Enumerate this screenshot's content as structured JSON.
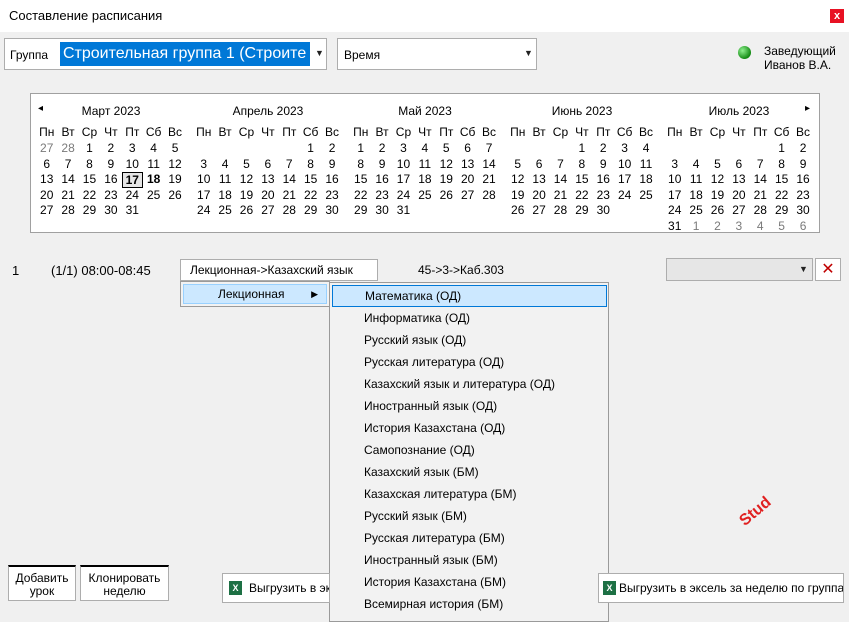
{
  "window": {
    "title": "Составление расписания",
    "close_label": "x"
  },
  "header": {
    "group_label": "Группа",
    "group_value": "Строительная группа 1 (Строите",
    "time_value": "Время",
    "user_role": "Заведующий",
    "user_name": "Иванов В.А.",
    "status_color": "#1a9a1a"
  },
  "calendar": {
    "prev_label": "◂",
    "next_label": "▸",
    "weekdays": [
      "Пн",
      "Вт",
      "Ср",
      "Чт",
      "Пт",
      "Сб",
      "Вс"
    ],
    "months": [
      {
        "title": "Март 2023",
        "weeks": [
          [
            "27",
            "28",
            "1",
            "2",
            "3",
            "4",
            "5"
          ],
          [
            "6",
            "7",
            "8",
            "9",
            "10",
            "11",
            "12"
          ],
          [
            "13",
            "14",
            "15",
            "16",
            "17",
            "18",
            "19"
          ],
          [
            "20",
            "21",
            "22",
            "23",
            "24",
            "25",
            "26"
          ],
          [
            "27",
            "28",
            "29",
            "30",
            "31",
            "",
            ""
          ]
        ],
        "dim": [
          [
            0,
            0
          ],
          [
            0,
            1
          ]
        ],
        "today": [
          2,
          4
        ],
        "bold": [
          [
            2,
            5
          ]
        ]
      },
      {
        "title": "Апрель 2023",
        "weeks": [
          [
            "",
            "",
            "",
            "",
            "",
            "1",
            "2"
          ],
          [
            "3",
            "4",
            "5",
            "6",
            "7",
            "8",
            "9"
          ],
          [
            "10",
            "11",
            "12",
            "13",
            "14",
            "15",
            "16"
          ],
          [
            "17",
            "18",
            "19",
            "20",
            "21",
            "22",
            "23"
          ],
          [
            "24",
            "25",
            "26",
            "27",
            "28",
            "29",
            "30"
          ]
        ],
        "dim": [],
        "today": null,
        "bold": []
      },
      {
        "title": "Май 2023",
        "weeks": [
          [
            "1",
            "2",
            "3",
            "4",
            "5",
            "6",
            "7"
          ],
          [
            "8",
            "9",
            "10",
            "11",
            "12",
            "13",
            "14"
          ],
          [
            "15",
            "16",
            "17",
            "18",
            "19",
            "20",
            "21"
          ],
          [
            "22",
            "23",
            "24",
            "25",
            "26",
            "27",
            "28"
          ],
          [
            "29",
            "30",
            "31",
            "",
            "",
            "",
            ""
          ]
        ],
        "dim": [],
        "today": null,
        "bold": []
      },
      {
        "title": "Июнь 2023",
        "weeks": [
          [
            "",
            "",
            "",
            "1",
            "2",
            "3",
            "4"
          ],
          [
            "5",
            "6",
            "7",
            "8",
            "9",
            "10",
            "11"
          ],
          [
            "12",
            "13",
            "14",
            "15",
            "16",
            "17",
            "18"
          ],
          [
            "19",
            "20",
            "21",
            "22",
            "23",
            "24",
            "25"
          ],
          [
            "26",
            "27",
            "28",
            "29",
            "30",
            "",
            ""
          ]
        ],
        "dim": [],
        "today": null,
        "bold": []
      },
      {
        "title": "Июль 2023",
        "weeks": [
          [
            "",
            "",
            "",
            "",
            "",
            "1",
            "2"
          ],
          [
            "3",
            "4",
            "5",
            "6",
            "7",
            "8",
            "9"
          ],
          [
            "10",
            "11",
            "12",
            "13",
            "14",
            "15",
            "16"
          ],
          [
            "17",
            "18",
            "19",
            "20",
            "21",
            "22",
            "23"
          ],
          [
            "24",
            "25",
            "26",
            "27",
            "28",
            "29",
            "30"
          ],
          [
            "31",
            "1",
            "2",
            "3",
            "4",
            "5",
            "6"
          ]
        ],
        "dim": [
          [
            5,
            1
          ],
          [
            5,
            2
          ],
          [
            5,
            3
          ],
          [
            5,
            4
          ],
          [
            5,
            5
          ],
          [
            5,
            6
          ]
        ],
        "today": null,
        "bold": []
      }
    ]
  },
  "lesson": {
    "number": "1",
    "time": "(1/1) 08:00-08:45",
    "type_button": "Лекционная->Казахский язык",
    "room": "45->3->Каб.303",
    "delete_label": "✕"
  },
  "context_menu": {
    "item": "Лекционная",
    "subjects": [
      "Математика (ОД)",
      "Информатика (ОД)",
      "Русский язык (ОД)",
      "Русская литература (ОД)",
      "Казахский язык и литература (ОД)",
      "Иностранный язык (ОД)",
      "История Казахстана (ОД)",
      "Самопознание (ОД)",
      "Казахский язык (БМ)",
      "Казахская литература (БМ)",
      "Русский язык (БМ)",
      "Русская литература (БМ)",
      "Иностранный язык (БМ)",
      "История Казахстана (БМ)",
      "Всемирная история (БМ)"
    ]
  },
  "footer": {
    "add_lesson_l1": "Добавить",
    "add_lesson_l2": "урок",
    "clone_week_l1": "Клонировать",
    "clone_week_l2": "неделю",
    "export_excel": "Выгрузить в экс",
    "export_excel_week": "Выгрузить в эксель за неделю по группам"
  },
  "watermark": "Stud"
}
